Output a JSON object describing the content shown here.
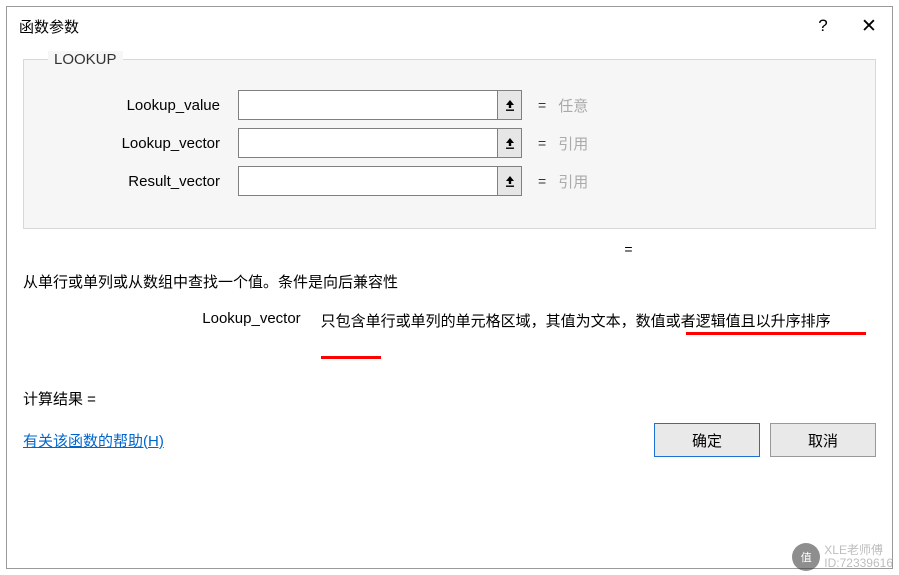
{
  "titlebar": {
    "title": "函数参数"
  },
  "group": {
    "legend": "LOOKUP",
    "params": [
      {
        "label": "Lookup_value",
        "value": "",
        "hint": "任意"
      },
      {
        "label": "Lookup_vector",
        "value": "",
        "hint": "引用"
      },
      {
        "label": "Result_vector",
        "value": "",
        "hint": "引用"
      }
    ],
    "eq": "="
  },
  "desc1": "从单行或单列或从数组中查找一个值。条件是向后兼容性",
  "paramHelp": {
    "name": "Lookup_vector",
    "text": "只包含单行或单列的单元格区域，其值为文本，数值或者逻辑值且以升序排序"
  },
  "result": {
    "label": "计算结果 ="
  },
  "footer": {
    "help": "有关该函数的帮助(H)",
    "ok": "确定",
    "cancel": "取消"
  },
  "watermark": {
    "line1": "XLE老师傅",
    "line2": "ID:72339616"
  }
}
